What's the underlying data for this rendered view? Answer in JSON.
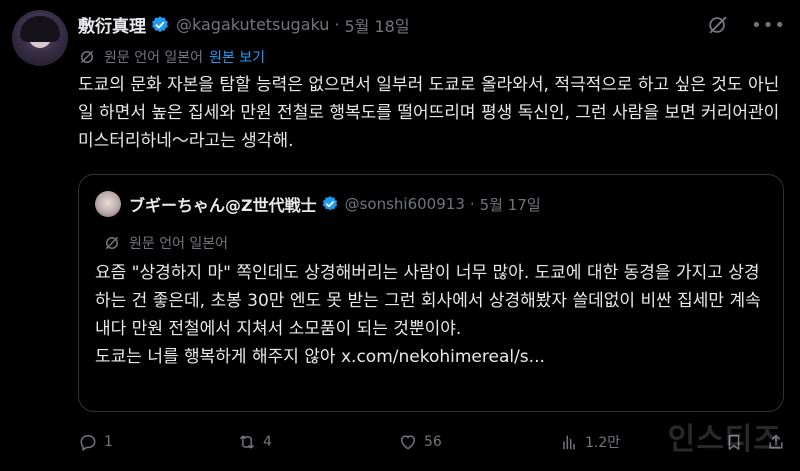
{
  "tweet": {
    "name": "敷衍真理",
    "handle": "@kagakutetsugaku",
    "separator": "·",
    "date": "5월 18일",
    "translate_note": "원문 언어 일본어",
    "show_original": "원본 보기",
    "text": "도쿄의 문화 자본을 탐할 능력은 없으면서 일부러 도쿄로 올라와서, 적극적으로 하고 싶은 것도 아닌 일 하면서 높은 집세와 만원 전철로 행복도를 떨어뜨리며 평생 독신인, 그런 사람을 보면 커리어관이 미스터리하네～라고는 생각해."
  },
  "quote": {
    "name": "ブギーちゃん@Z世代戦士",
    "handle": "@sonshi600913",
    "separator": "·",
    "date": "5월 17일",
    "translate_note": "원문 언어 일본어",
    "text": "요즘 \"상경하지 마\" 쪽인데도 상경해버리는 사람이 너무 많아. 도쿄에 대한 동경을 가지고 상경하는 건 좋은데, 초봉 30만 엔도 못 받는 그런 회사에서 상경해봤자 쓸데없이 비싼 집세만 계속 내다 만원 전철에서 지쳐서 소모품이 되는 것뿐이야.",
    "text_line2": "도쿄는 너를 행복하게 해주지 않아 x.com/nekohimereal/s..."
  },
  "actions": {
    "replies": "1",
    "retweets": "4",
    "likes": "56",
    "views": "1.2만"
  },
  "watermark": "인스티즈",
  "colors": {
    "background": "#000000",
    "text": "#e7e9ea",
    "muted": "#71767b",
    "accent": "#1d9bf0",
    "border": "#2f3336"
  },
  "icons": [
    "verified-badge-icon",
    "grok-icon",
    "more-icon",
    "globe-icon",
    "reply-icon",
    "retweet-icon",
    "like-icon",
    "views-icon",
    "bookmark-icon",
    "share-icon"
  ]
}
